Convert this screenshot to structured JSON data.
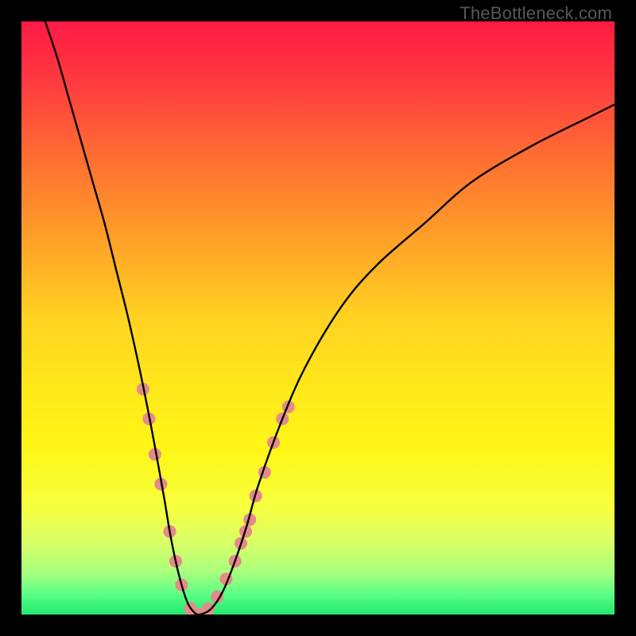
{
  "watermark": "TheBottleneck.com",
  "gradient": {
    "stops": [
      {
        "offset": 0.0,
        "color": "#ff1a44"
      },
      {
        "offset": 0.1,
        "color": "#ff3a3f"
      },
      {
        "offset": 0.22,
        "color": "#ff6a33"
      },
      {
        "offset": 0.35,
        "color": "#ff9a29"
      },
      {
        "offset": 0.5,
        "color": "#ffd221"
      },
      {
        "offset": 0.62,
        "color": "#ffe81a"
      },
      {
        "offset": 0.72,
        "color": "#fff617"
      },
      {
        "offset": 0.82,
        "color": "#f6ff40"
      },
      {
        "offset": 0.88,
        "color": "#d8ff68"
      },
      {
        "offset": 0.93,
        "color": "#a6ff7e"
      },
      {
        "offset": 0.965,
        "color": "#5cff86"
      },
      {
        "offset": 1.0,
        "color": "#22e86e"
      }
    ]
  },
  "chart_data": {
    "type": "line",
    "title": "",
    "xlabel": "",
    "ylabel": "",
    "xlim": [
      0,
      100
    ],
    "ylim": [
      0,
      100
    ],
    "series": [
      {
        "name": "bottleneck-curve",
        "x": [
          4,
          6,
          8,
          10,
          12,
          14,
          16,
          18,
          20,
          22,
          24,
          25,
          26,
          27,
          28,
          29,
          30,
          32,
          34,
          36,
          38,
          40,
          44,
          48,
          54,
          60,
          68,
          76,
          86,
          96,
          100
        ],
        "y": [
          100,
          94,
          87,
          80,
          73,
          66,
          58,
          50,
          41,
          31,
          20,
          14,
          9,
          5,
          2,
          0.5,
          0,
          1,
          4,
          9,
          15,
          22,
          33,
          42,
          52,
          59,
          66,
          73,
          79,
          84,
          86
        ]
      }
    ],
    "markers": {
      "name": "highlight-dots",
      "color": "#e58a8a",
      "radius_px": 8,
      "points": [
        {
          "x": 20.5,
          "y": 38
        },
        {
          "x": 21.5,
          "y": 33
        },
        {
          "x": 22.5,
          "y": 27
        },
        {
          "x": 23.5,
          "y": 22
        },
        {
          "x": 25.0,
          "y": 14
        },
        {
          "x": 26.0,
          "y": 9
        },
        {
          "x": 27.0,
          "y": 5
        },
        {
          "x": 28.5,
          "y": 1
        },
        {
          "x": 30.0,
          "y": 0
        },
        {
          "x": 31.5,
          "y": 1
        },
        {
          "x": 33.0,
          "y": 3
        },
        {
          "x": 34.5,
          "y": 6
        },
        {
          "x": 36.0,
          "y": 9
        },
        {
          "x": 37.0,
          "y": 12
        },
        {
          "x": 37.8,
          "y": 14
        },
        {
          "x": 38.5,
          "y": 16
        },
        {
          "x": 39.5,
          "y": 20
        },
        {
          "x": 41.0,
          "y": 24
        },
        {
          "x": 42.5,
          "y": 29
        },
        {
          "x": 44.0,
          "y": 33
        },
        {
          "x": 45.0,
          "y": 35
        }
      ]
    }
  }
}
